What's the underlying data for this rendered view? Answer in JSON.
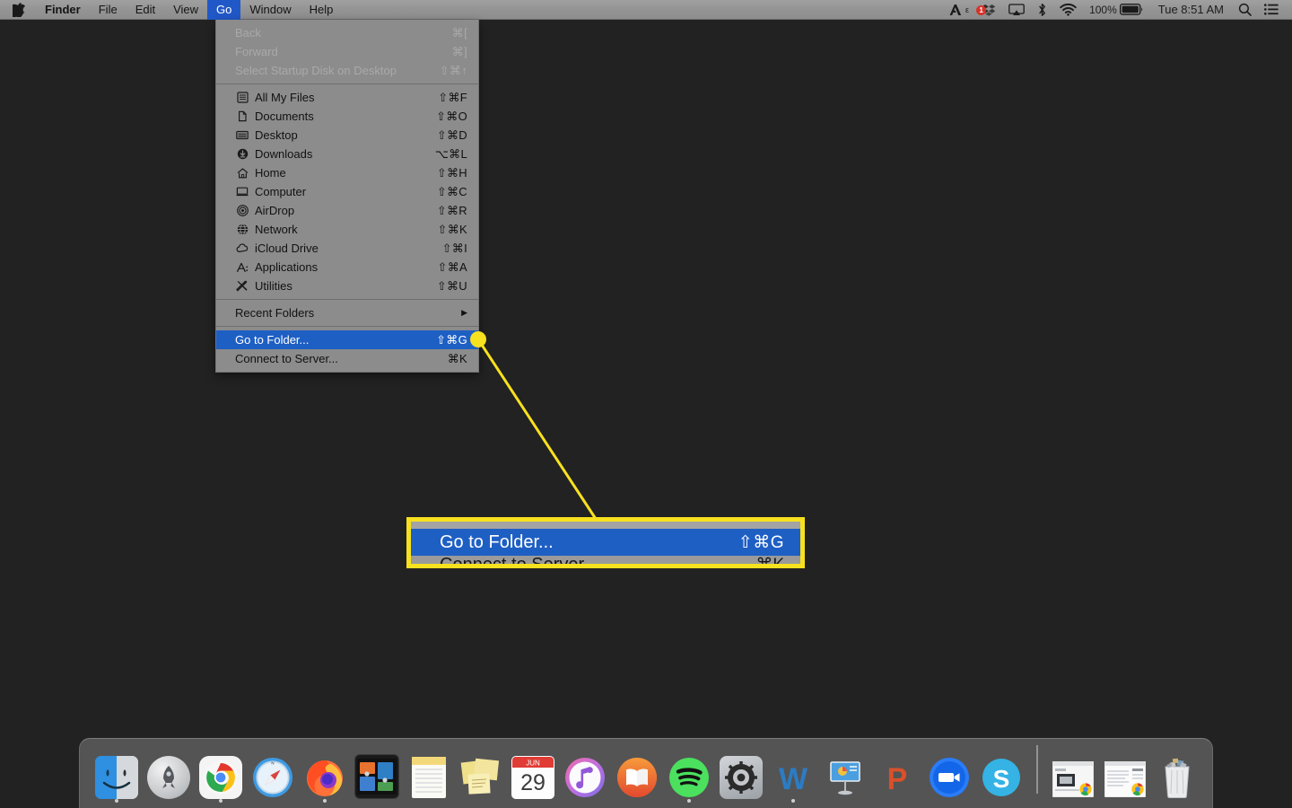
{
  "menubar": {
    "apple_icon": "apple-logo-icon",
    "items": [
      {
        "label": "Finder",
        "bold": true,
        "active": false
      },
      {
        "label": "File",
        "bold": false,
        "active": false
      },
      {
        "label": "Edit",
        "bold": false,
        "active": false
      },
      {
        "label": "View",
        "bold": false,
        "active": false
      },
      {
        "label": "Go",
        "bold": false,
        "active": true
      },
      {
        "label": "Window",
        "bold": false,
        "active": false
      },
      {
        "label": "Help",
        "bold": false,
        "active": false
      }
    ],
    "status": {
      "adobe_icon": "adobe-creative-cloud-icon",
      "dropbox_badge": "1",
      "airplay_icon": "airplay-icon",
      "bluetooth_icon": "bluetooth-icon",
      "wifi_icon": "wifi-icon",
      "battery_percent": "100%",
      "battery_icon": "battery-full-icon",
      "clock": "Tue 8:51 AM",
      "spotlight_icon": "search-icon",
      "notification_icon": "notification-center-icon"
    }
  },
  "go_menu": {
    "groups": [
      {
        "items": [
          {
            "label": "Back",
            "shortcut": "⌘[",
            "icon": "",
            "disabled": true,
            "selected": false
          },
          {
            "label": "Forward",
            "shortcut": "⌘]",
            "icon": "",
            "disabled": true,
            "selected": false
          },
          {
            "label": "Select Startup Disk on Desktop",
            "shortcut": "⇧⌘↑",
            "icon": "",
            "disabled": true,
            "selected": false
          }
        ]
      },
      {
        "items": [
          {
            "label": "All My Files",
            "shortcut": "⇧⌘F",
            "icon": "all-my-files-icon",
            "disabled": false,
            "selected": false
          },
          {
            "label": "Documents",
            "shortcut": "⇧⌘O",
            "icon": "documents-icon",
            "disabled": false,
            "selected": false
          },
          {
            "label": "Desktop",
            "shortcut": "⇧⌘D",
            "icon": "desktop-icon",
            "disabled": false,
            "selected": false
          },
          {
            "label": "Downloads",
            "shortcut": "⌥⌘L",
            "icon": "downloads-icon",
            "disabled": false,
            "selected": false
          },
          {
            "label": "Home",
            "shortcut": "⇧⌘H",
            "icon": "home-icon",
            "disabled": false,
            "selected": false
          },
          {
            "label": "Computer",
            "shortcut": "⇧⌘C",
            "icon": "computer-icon",
            "disabled": false,
            "selected": false
          },
          {
            "label": "AirDrop",
            "shortcut": "⇧⌘R",
            "icon": "airdrop-icon",
            "disabled": false,
            "selected": false
          },
          {
            "label": "Network",
            "shortcut": "⇧⌘K",
            "icon": "network-globe-icon",
            "disabled": false,
            "selected": false
          },
          {
            "label": "iCloud Drive",
            "shortcut": "⇧⌘I",
            "icon": "icloud-drive-icon",
            "disabled": false,
            "selected": false
          },
          {
            "label": "Applications",
            "shortcut": "⇧⌘A",
            "icon": "applications-icon",
            "disabled": false,
            "selected": false
          },
          {
            "label": "Utilities",
            "shortcut": "⇧⌘U",
            "icon": "utilities-icon",
            "disabled": false,
            "selected": false
          }
        ]
      },
      {
        "items": [
          {
            "label": "Recent Folders",
            "shortcut": "",
            "submenu": true,
            "icon": "",
            "disabled": false,
            "selected": false
          }
        ]
      },
      {
        "items": [
          {
            "label": "Go to Folder...",
            "shortcut": "⇧⌘G",
            "icon": "",
            "disabled": false,
            "selected": true
          },
          {
            "label": "Connect to Server...",
            "shortcut": "⌘K",
            "icon": "",
            "disabled": false,
            "selected": false
          }
        ]
      }
    ]
  },
  "callout": {
    "selected_label": "Go to Folder...",
    "selected_shortcut": "⇧⌘G",
    "next_label": "Connect to Server...",
    "next_shortcut": "⌘K",
    "border_color": "#f8e11e",
    "highlight_color": "#1e5fc4"
  },
  "dock": {
    "items": [
      {
        "name": "finder",
        "label": "Finder",
        "running": true
      },
      {
        "name": "launchpad",
        "label": "Launchpad",
        "running": false
      },
      {
        "name": "google-chrome",
        "label": "Google Chrome",
        "running": true
      },
      {
        "name": "safari",
        "label": "Safari",
        "running": false
      },
      {
        "name": "firefox",
        "label": "Firefox",
        "running": true
      },
      {
        "name": "mission-control",
        "label": "Mission Control",
        "running": false
      },
      {
        "name": "notes",
        "label": "Notes",
        "running": false
      },
      {
        "name": "stickies",
        "label": "Stickies",
        "running": false
      },
      {
        "name": "calendar",
        "label": "Calendar",
        "running": false,
        "month": "JUN",
        "day": "29"
      },
      {
        "name": "itunes",
        "label": "iTunes",
        "running": false
      },
      {
        "name": "ibooks",
        "label": "iBooks",
        "running": false
      },
      {
        "name": "spotify",
        "label": "Spotify",
        "running": true
      },
      {
        "name": "system-preferences",
        "label": "System Preferences",
        "running": false
      },
      {
        "name": "microsoft-word",
        "label": "Microsoft Word",
        "running": true
      },
      {
        "name": "keynote",
        "label": "Keynote",
        "running": false
      },
      {
        "name": "powerpoint",
        "label": "Microsoft PowerPoint",
        "running": false
      },
      {
        "name": "zoom",
        "label": "Zoom",
        "running": false
      },
      {
        "name": "skype",
        "label": "Skype",
        "running": false
      }
    ],
    "minimized": [
      {
        "name": "chrome-window-1",
        "label": "Chrome Window"
      },
      {
        "name": "chrome-window-2",
        "label": "Chrome Window"
      }
    ],
    "trash": {
      "name": "trash",
      "label": "Trash"
    }
  },
  "desktop": {
    "background_color": "#222222"
  }
}
